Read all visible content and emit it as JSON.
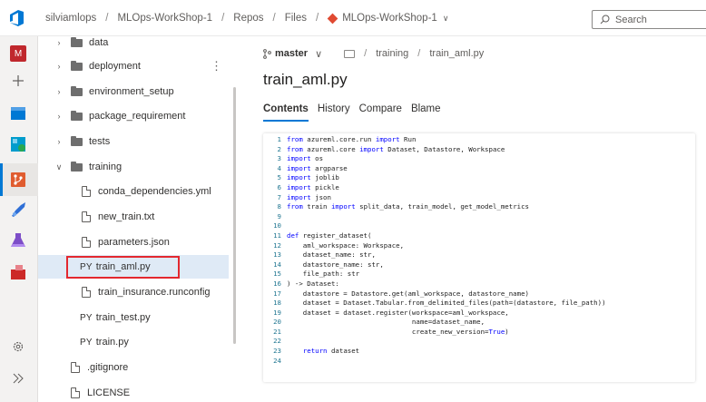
{
  "breadcrumb": {
    "org": "silviamlops",
    "project": "MLOps-WorkShop-1",
    "section1": "Repos",
    "section2": "Files",
    "repo": "MLOps-WorkShop-1"
  },
  "search": {
    "placeholder": "Search"
  },
  "rail": {
    "avatar_letter": "M",
    "colors": {
      "avatar": "#c0282d",
      "boards": "#0078d4",
      "repos": "#e05c2f",
      "pipelines": "#2f6fd6",
      "artifacts": "#cc2927"
    }
  },
  "tree": {
    "items": [
      {
        "type": "folder",
        "label": "data"
      },
      {
        "type": "folder",
        "label": "deployment"
      },
      {
        "type": "folder",
        "label": "environment_setup"
      },
      {
        "type": "folder",
        "label": "package_requirement"
      },
      {
        "type": "folder",
        "label": "tests"
      },
      {
        "type": "folder-open",
        "label": "training"
      },
      {
        "type": "file",
        "label": "conda_dependencies.yml"
      },
      {
        "type": "file",
        "label": "new_train.txt"
      },
      {
        "type": "file",
        "label": "parameters.json"
      },
      {
        "type": "py",
        "prefix": "PY",
        "label": "train_aml.py"
      },
      {
        "type": "file",
        "label": "train_insurance.runconfig"
      },
      {
        "type": "py",
        "prefix": "PY",
        "label": "train_test.py"
      },
      {
        "type": "py",
        "prefix": "PY",
        "label": "train.py"
      },
      {
        "type": "file",
        "label": ".gitignore"
      },
      {
        "type": "file",
        "label": "LICENSE"
      }
    ],
    "more_icon": "⋮"
  },
  "main": {
    "branch": "master",
    "path": [
      "training",
      "train_aml.py"
    ],
    "title": "train_aml.py",
    "tabs": [
      "Contents",
      "History",
      "Compare",
      "Blame"
    ]
  },
  "code": {
    "lines": [
      {
        "n": "1",
        "t": "from azureml.core.run import Run"
      },
      {
        "n": "2",
        "t": "from azureml.core import Dataset, Datastore, Workspace"
      },
      {
        "n": "3",
        "t": "import os"
      },
      {
        "n": "4",
        "t": "import argparse"
      },
      {
        "n": "5",
        "t": "import joblib"
      },
      {
        "n": "6",
        "t": "import pickle"
      },
      {
        "n": "7",
        "t": "import json"
      },
      {
        "n": "8",
        "t": "from train import split_data, train_model, get_model_metrics"
      },
      {
        "n": "9",
        "t": ""
      },
      {
        "n": "10",
        "t": ""
      },
      {
        "n": "11",
        "t": "def register_dataset("
      },
      {
        "n": "12",
        "t": "    aml_workspace: Workspace,"
      },
      {
        "n": "13",
        "t": "    dataset_name: str,"
      },
      {
        "n": "14",
        "t": "    datastore_name: str,"
      },
      {
        "n": "15",
        "t": "    file_path: str"
      },
      {
        "n": "16",
        "t": ") -> Dataset:"
      },
      {
        "n": "17",
        "t": "    datastore = Datastore.get(aml_workspace, datastore_name)"
      },
      {
        "n": "18",
        "t": "    dataset = Dataset.Tabular.from_delimited_files(path=(datastore, file_path))"
      },
      {
        "n": "19",
        "t": "    dataset = dataset.register(workspace=aml_workspace,"
      },
      {
        "n": "20",
        "t": "                               name=dataset_name,"
      },
      {
        "n": "21",
        "t": "                               create_new_version=True)"
      },
      {
        "n": "22",
        "t": ""
      },
      {
        "n": "23",
        "t": "    return dataset"
      },
      {
        "n": "24",
        "t": ""
      }
    ]
  }
}
